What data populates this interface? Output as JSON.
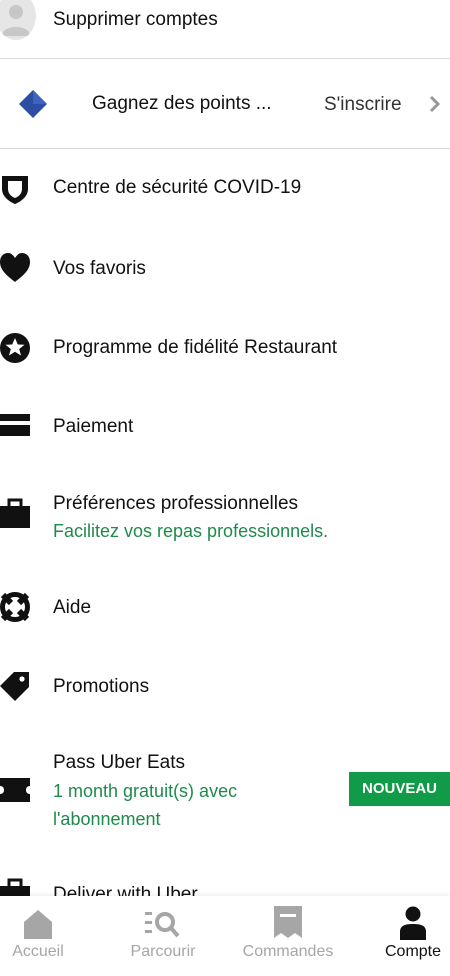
{
  "menu": {
    "delete_accounts": "Supprimer comptes",
    "rewards": {
      "label": "Gagnez des points ...",
      "action": "S'inscrire"
    },
    "items": [
      {
        "label": "Centre de sécurité COVID-19",
        "icon": "shield-icon"
      },
      {
        "label": "Vos favoris",
        "icon": "heart-icon"
      },
      {
        "label": "Programme de fidélité Restaurant",
        "icon": "star-icon"
      },
      {
        "label": "Paiement",
        "icon": "card-icon"
      },
      {
        "label": "Préférences professionnelles",
        "subtitle": "Facilitez vos repas professionnels.",
        "icon": "briefcase-icon"
      },
      {
        "label": "Aide",
        "icon": "lifebuoy-icon"
      },
      {
        "label": "Promotions",
        "icon": "tag-icon"
      },
      {
        "label": "Pass Uber Eats",
        "subtitle_line1": "1 month gratuit(s) avec",
        "subtitle_line2": "l'abonnement",
        "badge": "NOUVEAU",
        "icon": "ticket-icon"
      },
      {
        "label": "Deliver with Uber",
        "icon": "briefcase-icon"
      }
    ]
  },
  "tabbar": {
    "tabs": [
      {
        "label": "Accueil",
        "icon": "home-icon",
        "active": false
      },
      {
        "label": "Parcourir",
        "icon": "browse-search-icon",
        "active": false
      },
      {
        "label": "Commandes",
        "icon": "receipt-icon",
        "active": false
      },
      {
        "label": "Compte",
        "icon": "person-icon",
        "active": true
      }
    ]
  },
  "colors": {
    "accent_green": "#1f8a4c",
    "badge_green": "#119a48",
    "inactive": "#a6a6a6",
    "rewards_blue": "#2d4fa3"
  }
}
